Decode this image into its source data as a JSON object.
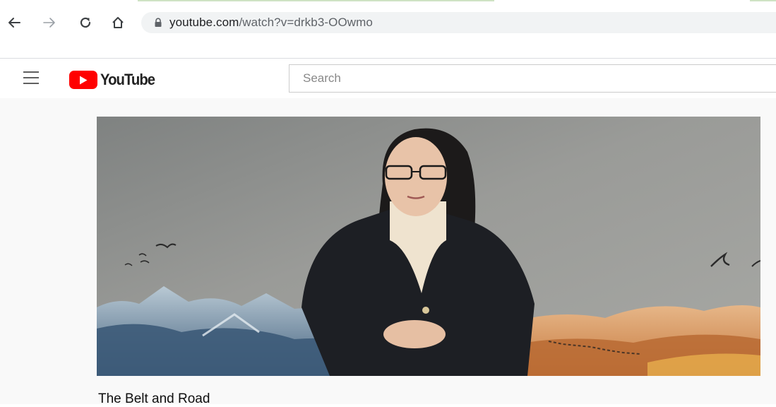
{
  "browser": {
    "url_domain": "youtube.com",
    "url_path": "/watch?v=drkb3-OOwmo"
  },
  "masthead": {
    "logo_text": "YouTube",
    "search_placeholder": "Search"
  },
  "video": {
    "title": "The Belt and Road"
  },
  "colors": {
    "youtube_red": "#ff0000",
    "omnibox_bg": "#f1f3f4",
    "page_bg": "#f9f9f9"
  },
  "icons": [
    "back-arrow-icon",
    "forward-arrow-icon",
    "reload-icon",
    "home-icon",
    "lock-icon",
    "hamburger-menu-icon",
    "play-icon"
  ]
}
